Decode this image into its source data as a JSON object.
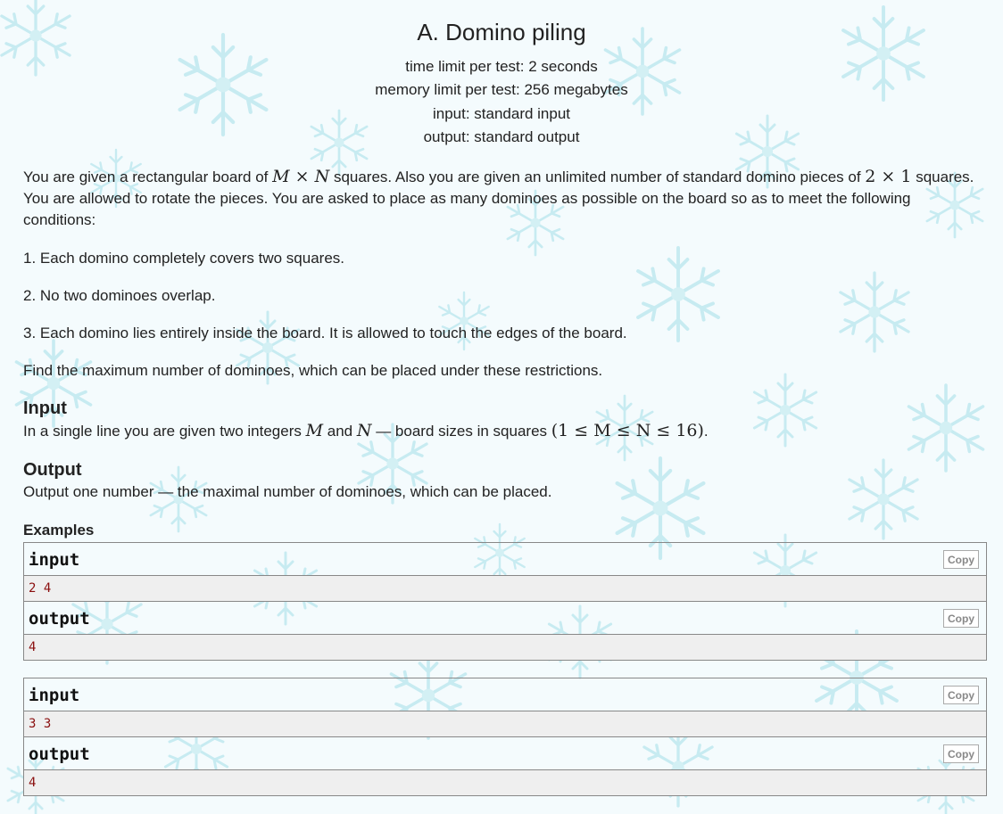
{
  "problem": {
    "title": "A. Domino piling",
    "time_limit": "time limit per test: 2 seconds",
    "memory_limit": "memory limit per test: 256 megabytes",
    "input_file": "input: standard input",
    "output_file": "output: standard output"
  },
  "statement": {
    "p1_a": "You are given a rectangular board of ",
    "p1_math1": "M × N",
    "p1_b": " squares. Also you are given an unlimited number of standard domino pieces of ",
    "p1_math2": "2 × 1",
    "p1_c": " squares.",
    "p1_line2": "You are allowed to rotate the pieces. You are asked to place as many dominoes as possible on the board so as to meet the following",
    "p1_line3": "conditions:",
    "cond1": "1. Each domino completely covers two squares.",
    "cond2": "2. No two dominoes overlap.",
    "cond3": "3. Each domino lies entirely inside the board. It is allowed to touch the edges of the board.",
    "task": "Find the maximum number of dominoes, which can be placed under these restrictions."
  },
  "input_spec": {
    "title": "Input",
    "text_a": "In a single line you are given two integers ",
    "math_m": "M",
    "text_b": " and ",
    "math_n": "N",
    "text_c": " — board sizes in squares ",
    "constraint": "(1 ≤ M ≤ N ≤ 16)",
    "text_d": "."
  },
  "output_spec": {
    "title": "Output",
    "text": "Output one number — the maximal number of dominoes, which can be placed."
  },
  "examples": {
    "title": "Examples",
    "input_label": "input",
    "output_label": "output",
    "copy_label": "Copy",
    "items": [
      {
        "input": "2 4",
        "output": "4"
      },
      {
        "input": "3 3",
        "output": "4"
      }
    ]
  },
  "theme": {
    "background": "#f4fbfd",
    "snowflake_color": "#bfe8ef",
    "sample_value_color": "#8a0e0e"
  }
}
